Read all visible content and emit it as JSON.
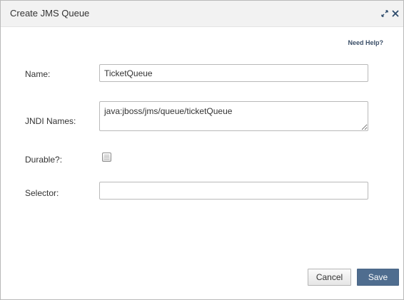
{
  "dialog": {
    "title": "Create JMS Queue",
    "icons": [
      "expand-icon",
      "close-icon"
    ]
  },
  "help": {
    "link_label": "Need Help?"
  },
  "form": {
    "name": {
      "label": "Name:",
      "value": "TicketQueue"
    },
    "jndi_names": {
      "label": "JNDI Names:",
      "value": "java:jboss/jms/queue/ticketQueue"
    },
    "durable": {
      "label": "Durable?:",
      "checked": false
    },
    "selector": {
      "label": "Selector:",
      "value": ""
    }
  },
  "buttons": {
    "cancel_label": "Cancel",
    "save_label": "Save"
  },
  "colors": {
    "primary_button": "#4f6d8f",
    "link": "#3b4f68",
    "titlebar": "#f2f2f2"
  }
}
